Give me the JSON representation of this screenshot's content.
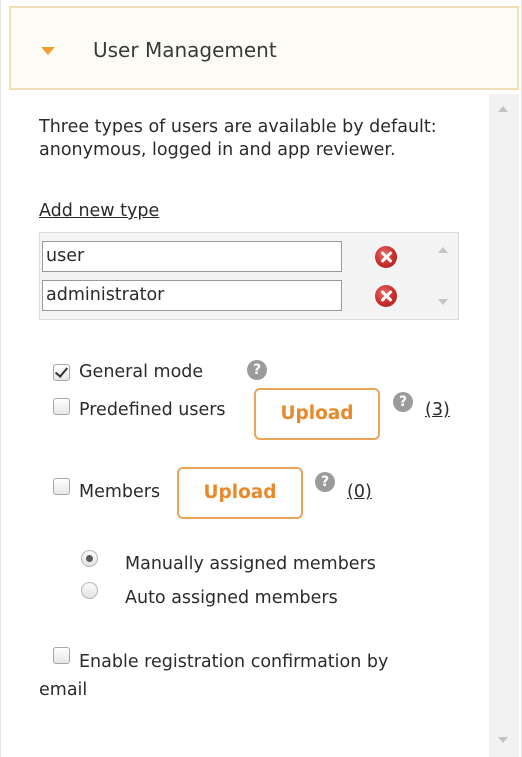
{
  "section": {
    "title": "User Management"
  },
  "description": "Three types of users are available by default: anonymous, logged in and app reviewer.",
  "add_type_link": "Add new type",
  "user_types": [
    {
      "value": "user"
    },
    {
      "value": "administrator"
    }
  ],
  "options": {
    "general_mode": {
      "label": "General mode",
      "checked": true
    },
    "predefined_users": {
      "label": "Predefined users",
      "checked": false,
      "upload_label": "Upload",
      "count": "(3)"
    },
    "members": {
      "label": "Members",
      "checked": false,
      "upload_label": "Upload",
      "count": "(0)"
    },
    "member_assignment": [
      {
        "label": "Manually assigned members",
        "selected": true
      },
      {
        "label": "Auto assigned members",
        "selected": false
      }
    ],
    "registration_confirmation": {
      "label": "Enable registration confirmation by",
      "label_cont": "email",
      "checked": false
    }
  },
  "icons": {
    "expand": "caret-down-icon",
    "help": "question-icon",
    "delete": "delete-icon"
  },
  "colors": {
    "accent": "#f29f36",
    "upload_text": "#e8892a",
    "upload_border": "#e9a55a",
    "header_border": "#f0e0b6",
    "delete": "#c72d2d"
  }
}
